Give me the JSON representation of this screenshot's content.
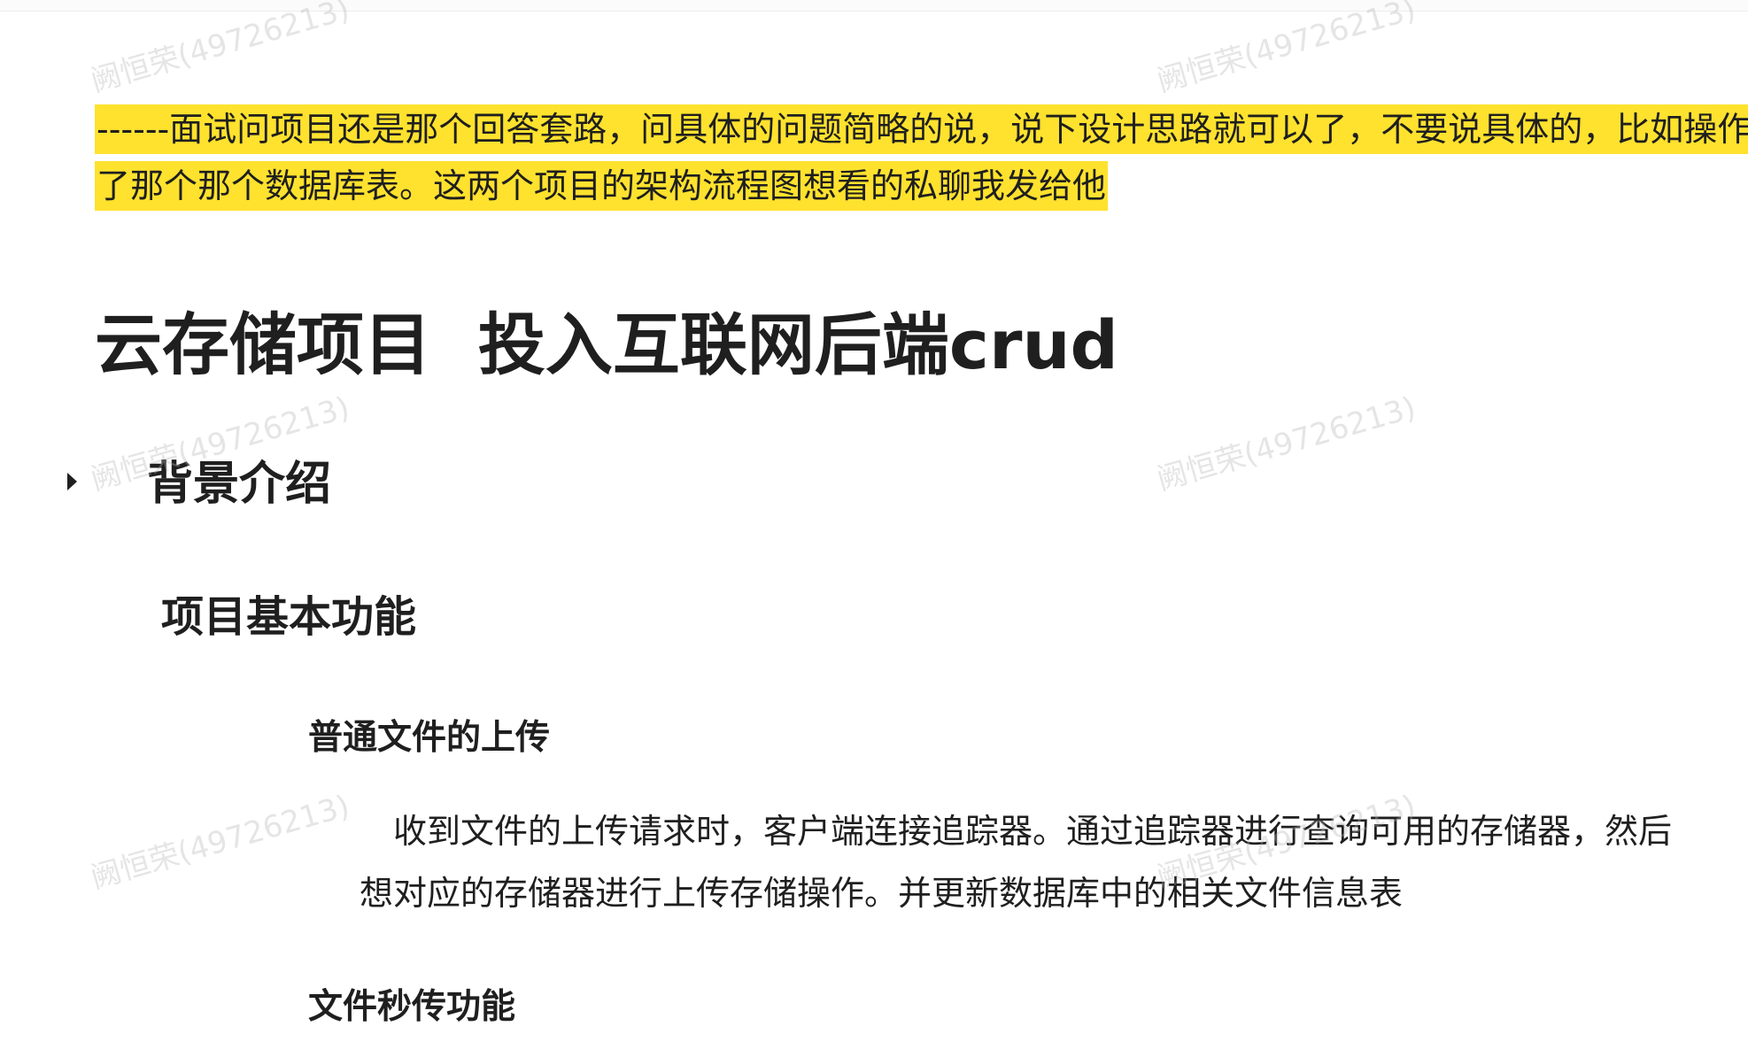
{
  "watermark_text": "阙恒荣(49726213)",
  "note": {
    "line1": "------面试问项目还是那个回答套路，问具体的问题简略的说，说下设计思路就可以了，不要说具体的，比如操作",
    "line2": "了那个那个数据库表。这两个项目的架构流程图想看的私聊我发给他",
    "highlight_color": "#ffe22e"
  },
  "title": "云存储项目  投入互联网后端crud",
  "section_background": "背景介绍",
  "section_features": "项目基本功能",
  "feature_upload": {
    "heading": "普通文件的上传",
    "line1": "收到文件的上传请求时，客户端连接追踪器。通过追踪器进行查询可用的存储器，然后",
    "line2": "想对应的存储器进行上传存储操作。并更新数据库中的相关文件信息表"
  },
  "feature_instant": {
    "heading": "文件秒传功能"
  }
}
